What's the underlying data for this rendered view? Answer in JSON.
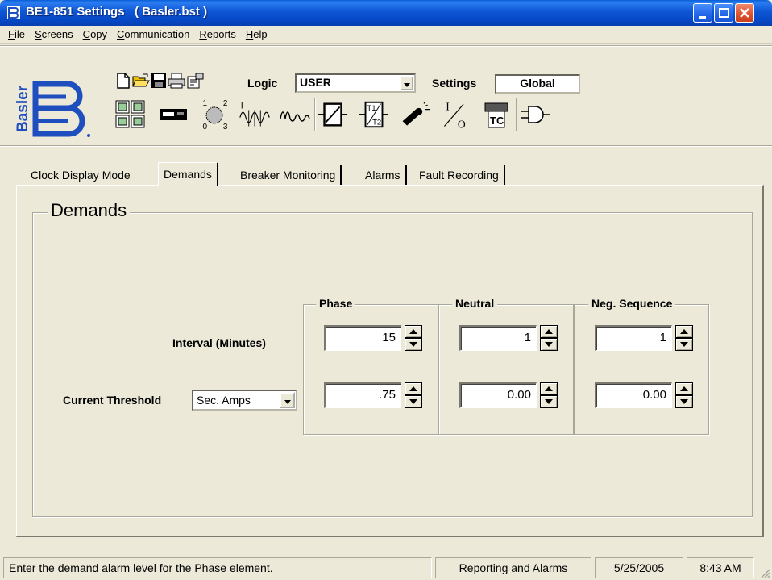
{
  "window": {
    "title": "BE1-851 Settings   ( Basler.bst )",
    "buttons": {
      "minimize": "minimize",
      "maximize": "maximize",
      "close": "close"
    }
  },
  "menu": [
    {
      "key": "F",
      "rest": "ile"
    },
    {
      "key": "S",
      "rest": "creens"
    },
    {
      "key": "C",
      "rest": "opy"
    },
    {
      "key": "C",
      "rest": "ommunication"
    },
    {
      "key": "R",
      "rest": "eports"
    },
    {
      "key": "H",
      "rest": "elp"
    }
  ],
  "logo_text": "Basler",
  "toolbar": {
    "logic_label": "Logic",
    "logic_value": "USER",
    "settings_label": "Settings",
    "settings_value": "Global",
    "small_icons": [
      "new-file-icon",
      "open-folder-icon",
      "save-disk-icon",
      "print-icon",
      "properties-icon"
    ],
    "big_icons": [
      "io-grid-icon",
      "relay-device-icon",
      "selector-dial-icon",
      "harmonic-waveform-icon",
      "pulse-waveform-icon",
      "protection-element-icon",
      "t1-t2-timer-icon",
      "breaker-spark-icon",
      "io-switch-icon",
      "tc-terminal-icon",
      "logic-gate-icon"
    ],
    "dial_labels": [
      "1",
      "2",
      "0",
      "3"
    ],
    "timer_labels": [
      "T1",
      "T2"
    ],
    "io_labels": [
      "I",
      "O"
    ],
    "tc_label": "TC",
    "harmonic_label": "I"
  },
  "tabs": [
    {
      "label": "Clock Display Mode",
      "active": false
    },
    {
      "label": "Demands",
      "active": true
    },
    {
      "label": "Breaker Monitoring",
      "active": false
    },
    {
      "label": "Alarms",
      "active": false
    },
    {
      "label": "Fault Recording",
      "active": false
    }
  ],
  "demands": {
    "title": "Demands",
    "interval_label": "Interval (Minutes)",
    "threshold_label": "Current Threshold",
    "threshold_unit": "Sec. Amps",
    "columns": [
      {
        "title": "Phase",
        "interval": "15",
        "threshold": ".75"
      },
      {
        "title": "Neutral",
        "interval": "1",
        "threshold": "0.00"
      },
      {
        "title": "Neg. Sequence",
        "interval": "1",
        "threshold": "0.00"
      }
    ]
  },
  "status": {
    "message": "Enter the demand alarm level for the Phase element.",
    "section": "Reporting and Alarms",
    "date": "5/25/2005",
    "time": "8:43 AM"
  },
  "colors": {
    "titlebar": "#0a5fd8",
    "face": "#ece9d8",
    "logo_blue": "#1f4fbf"
  }
}
